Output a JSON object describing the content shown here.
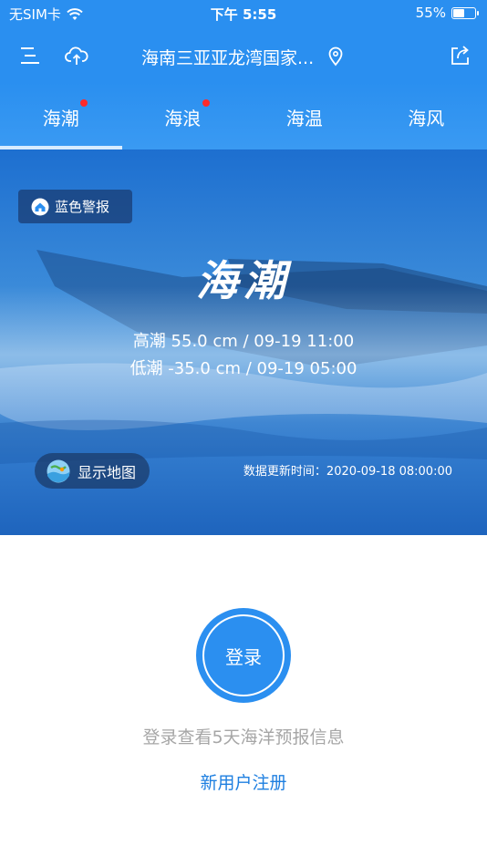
{
  "status_bar": {
    "carrier": "无SIM卡",
    "time": "下午 5:55",
    "battery": "55%",
    "battery_level": 0.55
  },
  "nav": {
    "menu_icon": "menu-icon",
    "upload_icon": "cloud-upload-icon",
    "location_title": "海南三亚亚龙湾国家...",
    "location_icon": "location-pin-icon",
    "share_icon": "share-icon"
  },
  "tabs": [
    {
      "label": "海潮",
      "has_dot": true,
      "active": true
    },
    {
      "label": "海浪",
      "has_dot": true,
      "active": false
    },
    {
      "label": "海温",
      "has_dot": false,
      "active": false
    },
    {
      "label": "海风",
      "has_dot": false,
      "active": false
    }
  ],
  "hero": {
    "alert_label": "蓝色警报",
    "title": "海潮",
    "high_tide": "高潮 55.0 cm / 09-19 11:00",
    "low_tide": "低潮 -35.0 cm / 09-19 05:00",
    "map_button": "显示地图",
    "update_time": "数据更新时间：2020-09-18 08:00:00"
  },
  "login": {
    "button_label": "登录",
    "hint": "登录查看5天海洋预报信息",
    "register_label": "新用户注册"
  },
  "colors": {
    "primary": "#2b8ff0",
    "alert_dot": "#ff2a2a",
    "hint_text": "#a6a6a6",
    "link": "#1e7fe0"
  }
}
